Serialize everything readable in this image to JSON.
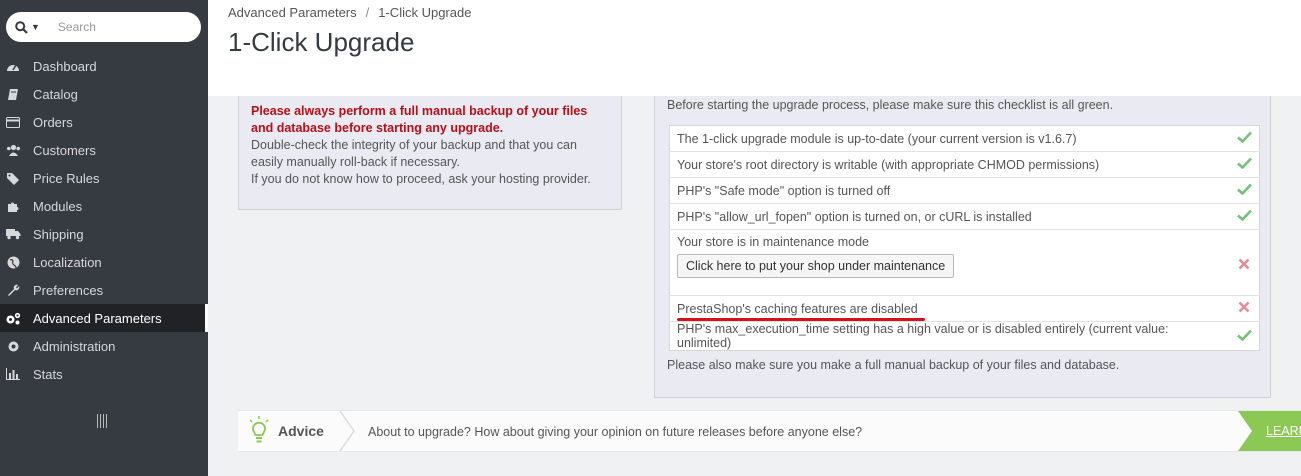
{
  "sidebar": {
    "search_placeholder": "Search",
    "items": [
      {
        "label": "Dashboard",
        "icon": "dashboard-icon"
      },
      {
        "label": "Catalog",
        "icon": "book-icon"
      },
      {
        "label": "Orders",
        "icon": "credit-card-icon"
      },
      {
        "label": "Customers",
        "icon": "users-icon"
      },
      {
        "label": "Price Rules",
        "icon": "tags-icon"
      },
      {
        "label": "Modules",
        "icon": "puzzle-icon"
      },
      {
        "label": "Shipping",
        "icon": "truck-icon"
      },
      {
        "label": "Localization",
        "icon": "globe-icon"
      },
      {
        "label": "Preferences",
        "icon": "wrench-icon"
      },
      {
        "label": "Advanced Parameters",
        "icon": "cogs-icon",
        "active": true
      },
      {
        "label": "Administration",
        "icon": "cog-icon"
      },
      {
        "label": "Stats",
        "icon": "bar-chart-icon"
      }
    ]
  },
  "header": {
    "breadcrumb": [
      "Advanced Parameters",
      "1-Click Upgrade"
    ],
    "breadcrumb_sep": "/",
    "title": "1-Click Upgrade"
  },
  "warning": {
    "strong": "Please always perform a full manual backup of your files and database before starting any upgrade.",
    "line1": "Double-check the integrity of your backup and that you can easily manually roll-back if necessary.",
    "line2": "If you do not know how to proceed, ask your hosting provider."
  },
  "checklist": {
    "intro": "Before starting the upgrade process, please make sure this checklist is all green.",
    "items": [
      {
        "text": "The 1-click upgrade module is up-to-date (your current version is v1.6.7)",
        "status": "ok"
      },
      {
        "text": "Your store's root directory is writable (with appropriate CHMOD permissions)",
        "status": "ok"
      },
      {
        "text": "PHP's \"Safe mode\" option is turned off",
        "status": "ok"
      },
      {
        "text": "PHP's \"allow_url_fopen\" option is turned on, or cURL is installed",
        "status": "ok"
      },
      {
        "text": "Your store is in maintenance mode",
        "status": "fail",
        "button": "Click here to put your shop under maintenance"
      },
      {
        "text": "PrestaShop's caching features are disabled",
        "status": "fail"
      },
      {
        "text": "PHP's max_execution_time setting has a high value or is disabled entirely (current value: unlimited)",
        "status": "ok"
      }
    ],
    "note": "Please also make sure you make a full manual backup of your files and database."
  },
  "advice": {
    "label": "Advice",
    "text": "About to upgrade? How about giving your opinion on future releases before anyone else?",
    "link": "LEARN MORE"
  },
  "colors": {
    "sidebar_bg": "#363a41",
    "ok": "#72c279",
    "fail": "#e08f95",
    "warning_text": "#b3101a",
    "advice_green": "#8bc954"
  }
}
